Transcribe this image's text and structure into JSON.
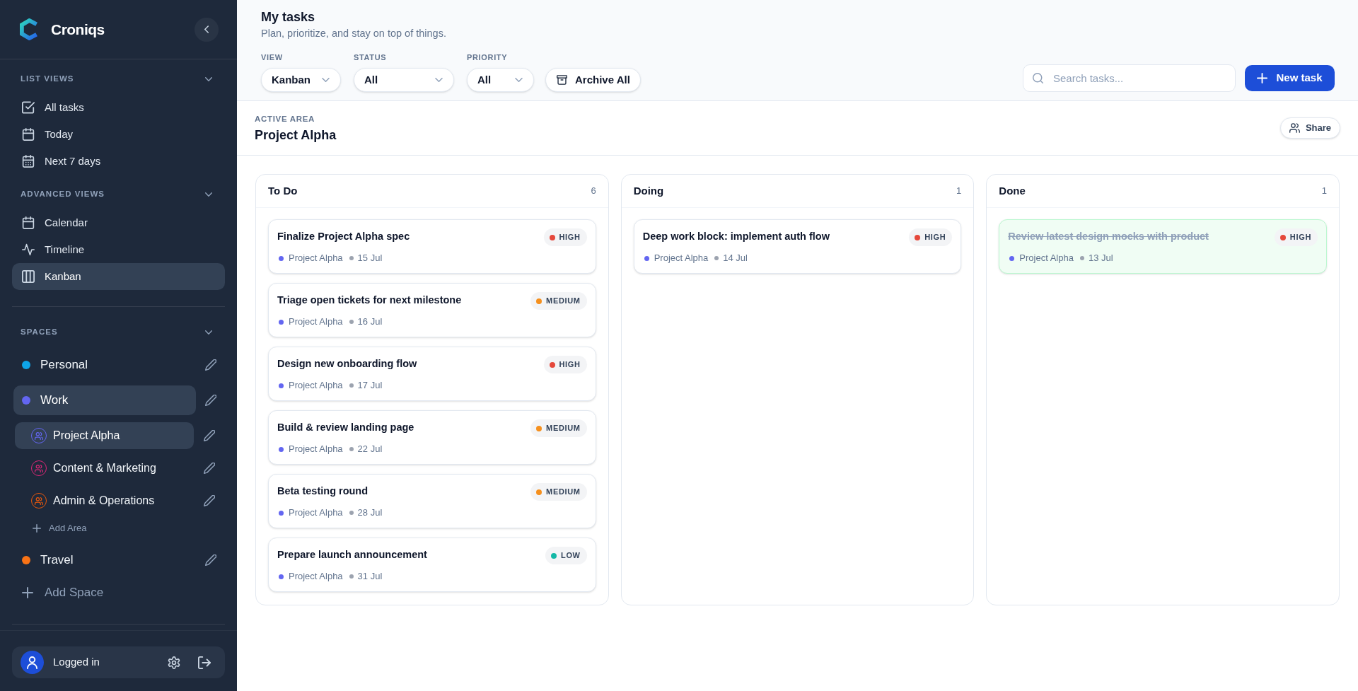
{
  "sidebar": {
    "brand": "Croniqs",
    "sections": [
      {
        "title": "LIST VIEWS",
        "expanded": true,
        "items": [
          {
            "label": "All tasks",
            "selected": false
          },
          {
            "label": "Today",
            "selected": false
          },
          {
            "label": "Next 7 days",
            "selected": false
          }
        ]
      },
      {
        "title": "ADVANCED VIEWS",
        "expanded": true,
        "items": [
          {
            "label": "Calendar",
            "selected": false
          },
          {
            "label": "Timeline",
            "selected": false
          },
          {
            "label": "Kanban",
            "selected": true
          }
        ]
      }
    ],
    "spaces": {
      "title": "SPACES",
      "expanded": true,
      "items": [
        {
          "name": "Personal",
          "color": "#0ea5e9",
          "selected": false
        },
        {
          "name": "Work",
          "color": "#6366f1",
          "selected": true,
          "children": [
            {
              "name": "Project Alpha",
              "color": "#6366f1",
              "selected": true
            },
            {
              "name": "Content & Marketing",
              "color": "#db2777",
              "selected": false
            },
            {
              "name": "Admin & Operations",
              "color": "#ea580c",
              "selected": false
            }
          ],
          "add_area": "Add Area"
        },
        {
          "name": "Travel",
          "color": "#f97316",
          "selected": false
        }
      ],
      "add_space": "Add Space"
    },
    "user": {
      "label": "Logged in"
    }
  },
  "header": {
    "title": "My tasks",
    "subtitle": "Plan, prioritize, and stay on top of things.",
    "filters": [
      {
        "label": "VIEW",
        "value": "Kanban"
      },
      {
        "label": "STATUS",
        "value": "All"
      },
      {
        "label": "PRIORITY",
        "value": "All"
      }
    ],
    "archive_button": "Archive All",
    "search": {
      "placeholder": "Search tasks..."
    },
    "new_button": "New task"
  },
  "active_area": {
    "label": "ACTIVE AREA",
    "name": "Project Alpha",
    "share_button": "Share"
  },
  "board": {
    "columns": [
      {
        "title": "To Do",
        "count": "6",
        "cards": [
          {
            "title": "Finalize Project Alpha spec",
            "done": false,
            "priority": {
              "label": "HIGH",
              "color": "#e5483b"
            },
            "project": {
              "name": "Project Alpha",
              "color": "#6366f1"
            },
            "date": "15 Jul"
          },
          {
            "title": "Triage open tickets for next milestone",
            "done": false,
            "priority": {
              "label": "MEDIUM",
              "color": "#f5901e"
            },
            "project": {
              "name": "Project Alpha",
              "color": "#6366f1"
            },
            "date": "16 Jul"
          },
          {
            "title": "Design new onboarding flow",
            "done": false,
            "priority": {
              "label": "HIGH",
              "color": "#e5483b"
            },
            "project": {
              "name": "Project Alpha",
              "color": "#6366f1"
            },
            "date": "17 Jul"
          },
          {
            "title": "Build & review landing page",
            "done": false,
            "priority": {
              "label": "MEDIUM",
              "color": "#f5901e"
            },
            "project": {
              "name": "Project Alpha",
              "color": "#6366f1"
            },
            "date": "22 Jul"
          },
          {
            "title": "Beta testing round",
            "done": false,
            "priority": {
              "label": "MEDIUM",
              "color": "#f5901e"
            },
            "project": {
              "name": "Project Alpha",
              "color": "#6366f1"
            },
            "date": "28 Jul"
          },
          {
            "title": "Prepare launch announcement",
            "done": false,
            "priority": {
              "label": "LOW",
              "color": "#14b8a6"
            },
            "project": {
              "name": "Project Alpha",
              "color": "#6366f1"
            },
            "date": "31 Jul"
          }
        ]
      },
      {
        "title": "Doing",
        "count": "1",
        "cards": [
          {
            "title": "Deep work block: implement auth flow",
            "done": false,
            "priority": {
              "label": "HIGH",
              "color": "#e5483b"
            },
            "project": {
              "name": "Project Alpha",
              "color": "#6366f1"
            },
            "date": "14 Jul"
          }
        ]
      },
      {
        "title": "Done",
        "count": "1",
        "cards": [
          {
            "title": "Review latest design mocks with product",
            "done": true,
            "priority": {
              "label": "HIGH",
              "color": "#e5483b"
            },
            "project": {
              "name": "Project Alpha",
              "color": "#6366f1"
            },
            "date": "13 Jul"
          }
        ]
      }
    ]
  }
}
